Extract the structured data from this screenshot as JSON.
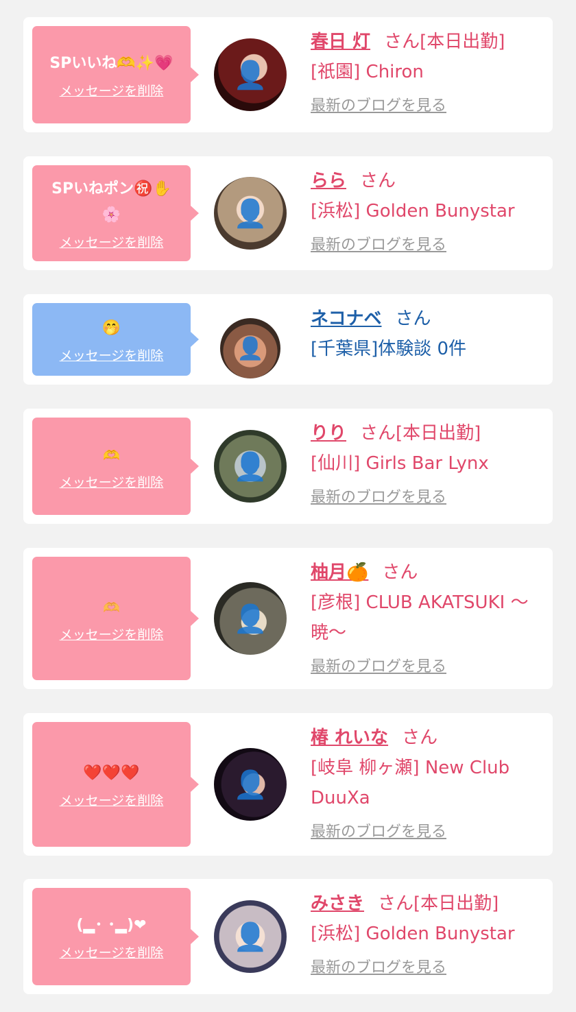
{
  "delete_label": "メッセージを削除",
  "blog_label": "最新のブログを見る",
  "items": [
    {
      "msg": "SPいいね🫶✨💗",
      "name": "春日 灯",
      "san": "さん[本日出勤]",
      "shop": "[祇園] Chiron",
      "blog": true
    },
    {
      "msg": "SPいねポン㊗️✋🌸",
      "name": "らら",
      "san": "さん",
      "shop": "[浜松] Golden Bunystar",
      "blog": true
    },
    {
      "msg": "🤭",
      "name": "ネコナベ",
      "san": "さん",
      "shop": "[千葉県]体験談 0件",
      "blog": false
    },
    {
      "msg": "🫶",
      "name": "りり",
      "san": "さん[本日出勤]",
      "shop": "[仙川] Girls Bar Lynx",
      "blog": true
    },
    {
      "msg": "🫶",
      "name": "柚月🍊",
      "san": "さん",
      "shop": "[彦根] CLUB AKATSUKI ～暁～",
      "blog": true
    },
    {
      "msg": "❤️❤️❤️",
      "name": "椿 れいな",
      "san": "さん",
      "shop": "[岐阜 柳ヶ瀬] New Club DuuXa",
      "blog": true
    },
    {
      "msg": "(▂･ ･▂)❤",
      "name": "みさき",
      "san": "さん[本日出勤]",
      "shop": "[浜松] Golden Bunystar",
      "blog": true
    }
  ]
}
